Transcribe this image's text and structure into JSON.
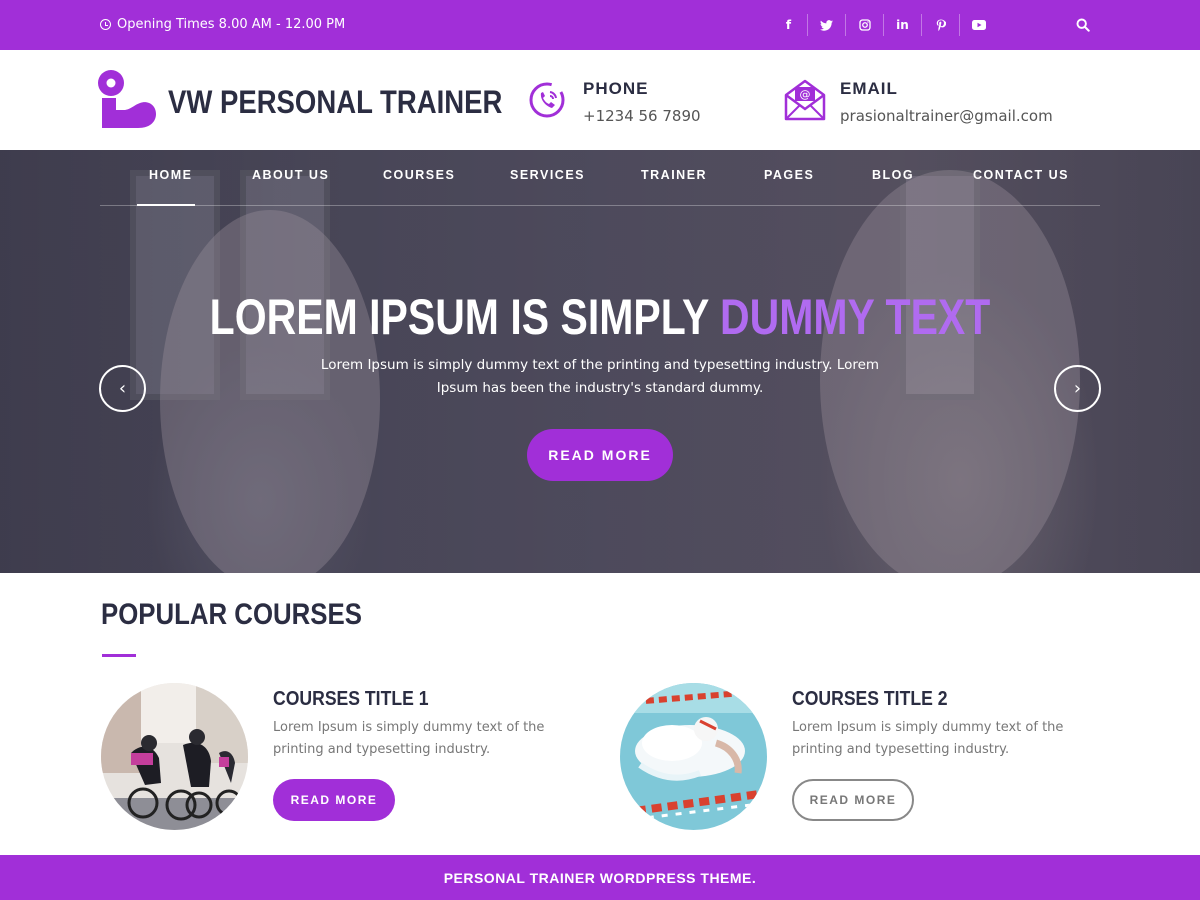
{
  "topbar": {
    "hours_text": "Opening Times 8.00 AM - 12.00 PM",
    "social": [
      {
        "name": "facebook-icon",
        "glyph": "f"
      },
      {
        "name": "twitter-icon",
        "glyph": "t"
      },
      {
        "name": "instagram-icon",
        "glyph": "◎"
      },
      {
        "name": "linkedin-icon",
        "glyph": "in"
      },
      {
        "name": "pinterest-icon",
        "glyph": "p"
      },
      {
        "name": "youtube-icon",
        "glyph": "▶"
      }
    ]
  },
  "header": {
    "site_title": "VW PERSONAL TRAINER",
    "phone": {
      "label": "PHONE",
      "value": "+1234 56 7890"
    },
    "email": {
      "label": "EMAIL",
      "value": "prasionaltrainer@gmail.com"
    }
  },
  "nav": {
    "items": [
      "HOME",
      "ABOUT US",
      "COURSES",
      "SERVICES",
      "TRAINER",
      "PAGES",
      "BLOG",
      "CONTACT US"
    ],
    "active": "HOME"
  },
  "hero": {
    "title_plain": "LOREM IPSUM IS SIMPLY ",
    "title_accent": "DUMMY TEXT",
    "subtitle": "Lorem Ipsum is simply dummy text of the printing and typesetting industry. Lorem Ipsum has been the industry's standard dummy.",
    "button": "READ MORE",
    "prev": "‹",
    "next": "›"
  },
  "courses": {
    "heading": "POPULAR COURSES",
    "items": [
      {
        "title": "COURSES TITLE 1",
        "desc": "Lorem Ipsum is simply dummy text of the printing and typesetting industry.",
        "button": "READ MORE"
      },
      {
        "title": "COURSES TITLE 2",
        "desc": "Lorem Ipsum is simply dummy text of the printing and typesetting industry.",
        "button": "READ MORE"
      }
    ]
  },
  "footer": {
    "text": "PERSONAL TRAINER WORDPRESS THEME."
  },
  "colors": {
    "accent": "#a12fd8",
    "dark": "#2b2d42"
  }
}
